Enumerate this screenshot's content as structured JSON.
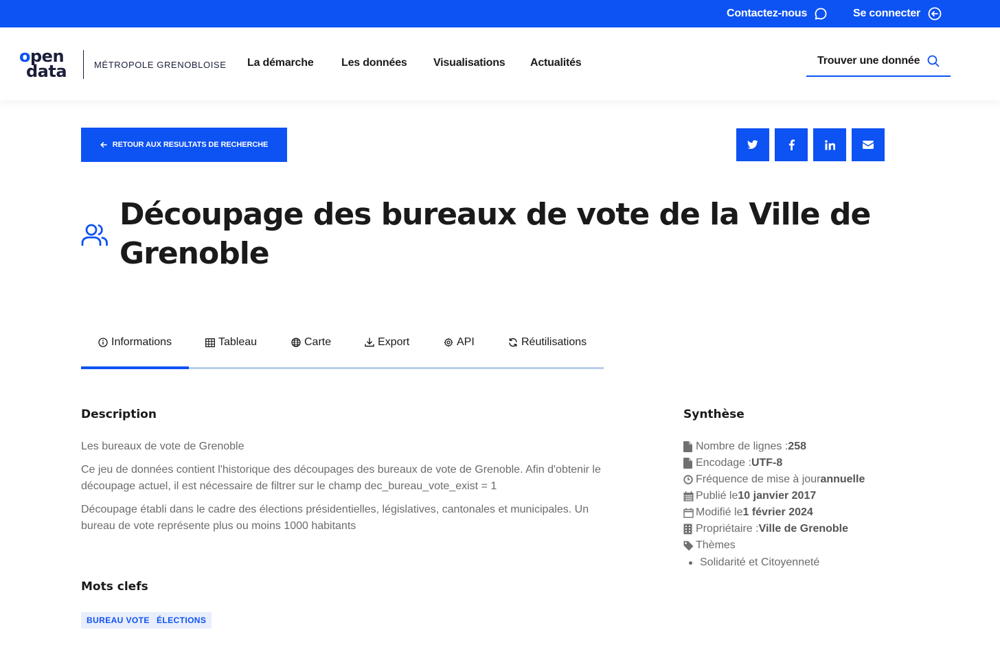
{
  "topbar": {
    "contact_label": "Contactez-nous",
    "login_label": "Se connecter"
  },
  "header": {
    "logo_line1": "pen",
    "logo_line1_first": "o",
    "logo_line2": "data",
    "logo_subtitle": "MÉTROPOLE GRENOBLOISE",
    "nav": [
      "La démarche",
      "Les données",
      "Visualisations",
      "Actualités"
    ],
    "search_label": "Trouver une donnée"
  },
  "back_label": "RETOUR AUX RESULTATS DE RECHERCHE",
  "share": [
    "twitter-icon",
    "facebook-icon",
    "linkedin-icon",
    "email-icon"
  ],
  "page_title": "Découpage des bureaux de vote de la Ville de Grenoble",
  "tabs": [
    {
      "label": "Informations",
      "icon": "info-icon",
      "active": true
    },
    {
      "label": "Tableau",
      "icon": "table-icon"
    },
    {
      "label": "Carte",
      "icon": "globe-icon"
    },
    {
      "label": "Export",
      "icon": "download-icon"
    },
    {
      "label": "API",
      "icon": "gear-icon"
    },
    {
      "label": "Réutilisations",
      "icon": "refresh-icon"
    }
  ],
  "description": {
    "heading": "Description",
    "paragraphs": [
      "Les bureaux de vote de Grenoble",
      "Ce jeu de données contient l'historique des découpages des bureaux de vote de Grenoble. Afin d'obtenir le découpage actuel, il est nécessaire de filtrer sur le champ dec_bureau_vote_exist = 1",
      "Découpage établi dans le cadre des élections présidentielles, législatives, cantonales et municipales. Un bureau de vote représente plus ou moins 1000 habitants"
    ]
  },
  "keywords": {
    "heading": "Mots clefs",
    "tags": [
      "BUREAU VOTE",
      "ÉLECTIONS"
    ]
  },
  "synthese": {
    "heading": "Synthèse",
    "lines": [
      {
        "label": "Nombre de lignes : ",
        "value": "258",
        "icon": "file-icon"
      },
      {
        "label": "Encodage : ",
        "value": "UTF-8",
        "icon": "file-icon"
      },
      {
        "label": "Fréquence de mise à jour ",
        "value": "annuelle",
        "icon": "clock-icon"
      },
      {
        "label": "Publié le ",
        "value": "10 janvier 2017",
        "icon": "calendar-icon"
      },
      {
        "label": "Modifié le ",
        "value": "1 février 2024",
        "icon": "calendar-outline-icon"
      },
      {
        "label": "Propriétaire : ",
        "value": "Ville de Grenoble",
        "icon": "building-icon"
      },
      {
        "label": "Thèmes",
        "value": "",
        "icon": "tag-icon"
      }
    ],
    "themes": [
      "Solidarité et Citoyenneté"
    ]
  },
  "colors": {
    "accent": "#0d52f2",
    "tab_track": "#b8cdea",
    "tag_bg": "#e8eefb",
    "muted_text": "#6b6b6b"
  }
}
